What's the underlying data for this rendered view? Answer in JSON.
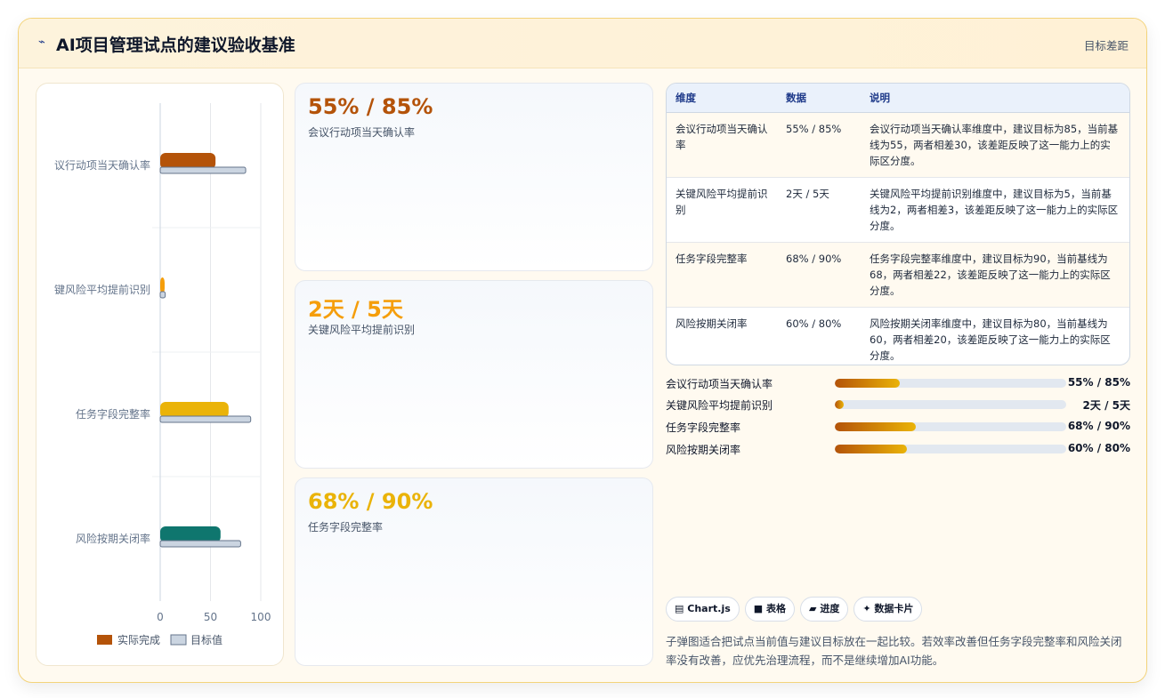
{
  "header": {
    "icon": "sparkline-icon",
    "title": "AI项目管理试点的建议验收基准",
    "subtitle": "目标差距"
  },
  "chart_data": {
    "type": "bar",
    "orientation": "horizontal",
    "categories": [
      "议行动项当天确认率",
      "键风险平均提前识别",
      "任务字段完整率",
      "风险按期关闭率"
    ],
    "series": [
      {
        "name": "实际完成",
        "values": [
          55,
          2,
          68,
          60
        ]
      },
      {
        "name": "目标值",
        "values": [
          85,
          5,
          90,
          80
        ]
      }
    ],
    "bar_colors": [
      "#b45309",
      "#f59e0b",
      "#eab308",
      "#0f766e"
    ],
    "target_color": "#cbd5e1",
    "xlim": [
      0,
      100
    ],
    "x_ticks": [
      "0",
      "50",
      "100"
    ],
    "legend": "bottom"
  },
  "cards": [
    {
      "value": "55% / 85%",
      "label": "会议行动项当天确认率",
      "color": "#b45309"
    },
    {
      "value": "2天 / 5天",
      "label": "关键风险平均提前识别",
      "color": "#f59e0b"
    },
    {
      "value": "68% / 90%",
      "label": "任务字段完整率",
      "color": "#eab308"
    }
  ],
  "table": {
    "headers": [
      "维度",
      "数据",
      "说明"
    ],
    "rows": [
      [
        "会议行动项当天确认率",
        "55% / 85%",
        "会议行动项当天确认率维度中，建议目标为85，当前基线为55，两者相差30，该差距反映了这一能力上的实际区分度。"
      ],
      [
        "关键风险平均提前识别",
        "2天 / 5天",
        "关键风险平均提前识别维度中，建议目标为5，当前基线为2，两者相差3，该差距反映了这一能力上的实际区分度。"
      ],
      [
        "任务字段完整率",
        "68% / 90%",
        "任务字段完整率维度中，建议目标为90，当前基线为68，两者相差22，该差距反映了这一能力上的实际区分度。"
      ],
      [
        "风险按期关闭率",
        "60% / 80%",
        "风险按期关闭率维度中，建议目标为80，当前基线为60，两者相差20，该差距反映了这一能力上的实际区分度。"
      ]
    ]
  },
  "progress": [
    {
      "label": "会议行动项当天确认率",
      "value": "55% / 85%",
      "fraction": 0.28
    },
    {
      "label": "关键风险平均提前识别",
      "value": "2天 / 5天",
      "fraction": 0.04
    },
    {
      "label": "任务字段完整率",
      "value": "68% / 90%",
      "fraction": 0.35
    },
    {
      "label": "风险按期关闭率",
      "value": "60% / 80%",
      "fraction": 0.31
    }
  ],
  "chips": [
    {
      "icon": "chart-icon",
      "glyph": "▤",
      "label": "Chart.js"
    },
    {
      "icon": "table-icon",
      "glyph": "■",
      "label": "表格"
    },
    {
      "icon": "progress-icon",
      "glyph": "▰",
      "label": "进度"
    },
    {
      "icon": "card-icon",
      "glyph": "✦",
      "label": "数据卡片"
    }
  ],
  "note": "子弹图适合把试点当前值与建议目标放在一起比较。若效率改善但任务字段完整率和风险关闭率没有改善，应优先治理流程，而不是继续增加AI功能。"
}
